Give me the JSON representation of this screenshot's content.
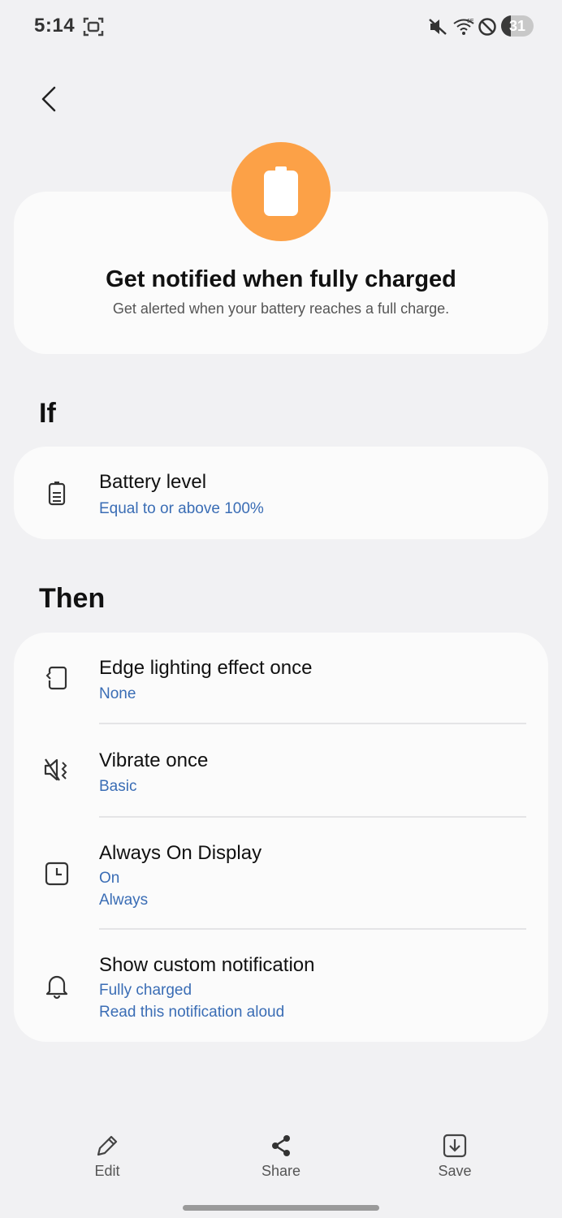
{
  "status_bar": {
    "time": "5:14",
    "battery": "31",
    "battery_fraction": 0.31,
    "icons": [
      "screenshot-icon",
      "mute-icon",
      "wifi-6e-icon",
      "do-not-disturb-icon"
    ]
  },
  "header": {
    "back_icon": "chevron-left-icon"
  },
  "hero": {
    "icon": "battery-icon",
    "accent": "#fca147",
    "title": "Get notified when fully charged",
    "subtitle": "Get alerted when your battery reaches a full charge."
  },
  "if_section": {
    "heading": "If",
    "items": [
      {
        "icon": "battery-level-icon",
        "title": "Battery level",
        "sub": [
          "Equal to or above 100%"
        ]
      }
    ]
  },
  "then_section": {
    "heading": "Then",
    "items": [
      {
        "icon": "edge-lighting-icon",
        "title": "Edge lighting effect once",
        "sub": [
          "None"
        ]
      },
      {
        "icon": "vibrate-icon",
        "title": "Vibrate once",
        "sub": [
          "Basic"
        ]
      },
      {
        "icon": "clock-icon",
        "title": "Always On Display",
        "sub": [
          "On",
          "Always"
        ]
      },
      {
        "icon": "bell-icon",
        "title": "Show custom notification",
        "sub": [
          "Fully charged",
          "Read this notification aloud"
        ]
      }
    ]
  },
  "bottom_bar": {
    "edit": "Edit",
    "share": "Share",
    "save": "Save"
  },
  "colors": {
    "link": "#3a6db5",
    "background": "#f1f1f3",
    "card": "#fbfbfb"
  }
}
